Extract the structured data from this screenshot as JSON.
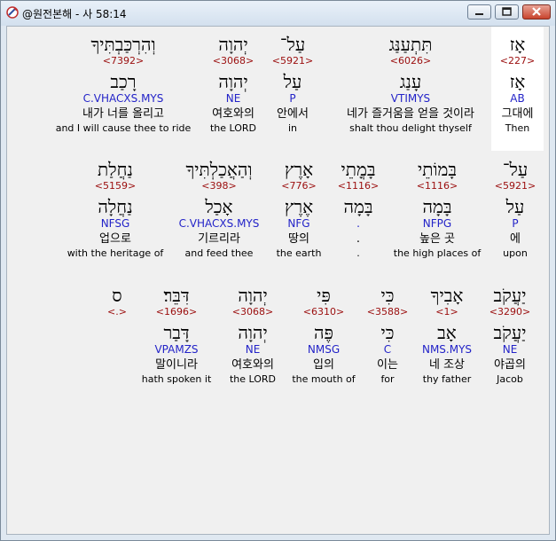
{
  "window": {
    "title": "@원전본해 - 사 58:14"
  },
  "rows": [
    [
      {
        "heb": "אָז",
        "num": "<227>",
        "lex": "אָז",
        "code": "AB",
        "kor": "그대에",
        "eng": "Then"
      },
      {
        "heb": "תִּתְעַנַּג",
        "num": "<6026>",
        "lex": "עָנַג",
        "code": "VTIMYS",
        "kor": "네가 즐거움을 얻을 것이라",
        "eng": "shalt thou delight thyself"
      },
      {
        "heb": "עַל־",
        "num": "<5921>",
        "lex": "עַל",
        "code": "P",
        "kor": "안에서",
        "eng": "in"
      },
      {
        "heb": "יְהוָה",
        "num": "<3068>",
        "lex": "יְהוָה",
        "code": "NE",
        "kor": "여호와의",
        "eng": "the LORD"
      },
      {
        "heb": "וְהִרְכַּבְתִּיךָ",
        "num": "<7392>",
        "lex": "רָכַב",
        "code": "C.VHACXS.MYS",
        "kor": "내가 너를 올리고",
        "eng": "and I will cause thee to ride"
      }
    ],
    [
      {
        "heb": "עַל־",
        "num": "<5921>",
        "lex": "עַל",
        "code": "P",
        "kor": "에",
        "eng": "upon"
      },
      {
        "heb": "בָּמוֹתֵי",
        "num": "<1116>",
        "lex": "בָּמָה",
        "code": "NFPG",
        "kor": "높은 곳",
        "eng": "the high places of"
      },
      {
        "heb": "בָּמֳתֵי",
        "num": "<1116>",
        "lex": "בָּמָה",
        "code": ".",
        "kor": ".",
        "eng": "."
      },
      {
        "heb": "אָרֶץ",
        "num": "<776>",
        "lex": "אֶרֶץ",
        "code": "NFG",
        "kor": "땅의",
        "eng": "the earth"
      },
      {
        "heb": "וְהַאֲכַלְתִּיךָ",
        "num": "<398>",
        "lex": "אָכַל",
        "code": "C.VHACXS.MYS",
        "kor": "기르리라",
        "eng": "and feed thee"
      },
      {
        "heb": "נַחֲלַת",
        "num": "<5159>",
        "lex": "נַחֲלָה",
        "code": "NFSG",
        "kor": "업으로",
        "eng": "with the heritage of"
      }
    ],
    [
      {
        "heb": "יַעֲקֹב",
        "num": "<3290>",
        "lex": "יַעֲקֹב",
        "code": "NE",
        "kor": "야곱의",
        "eng": "Jacob"
      },
      {
        "heb": "אָבִיךָ",
        "num": "<1>",
        "lex": "אָב",
        "code": "NMS.MYS",
        "kor": "네 조상",
        "eng": "thy father"
      },
      {
        "heb": "כִּי",
        "num": "<3588>",
        "lex": "כִּי",
        "code": "C",
        "kor": "이는",
        "eng": "for"
      },
      {
        "heb": "פִּי",
        "num": "<6310>",
        "lex": "פֶּה",
        "code": "NMSG",
        "kor": "입의",
        "eng": "the mouth of"
      },
      {
        "heb": "יְהוָה",
        "num": "<3068>",
        "lex": "יְהוָה",
        "code": "NE",
        "kor": "여호와의",
        "eng": "the LORD"
      },
      {
        "heb": "דִּבֵּר׃",
        "num": "<1696>",
        "lex": "דָּבַר",
        "code": "VPAMZS",
        "kor": "말이니라",
        "eng": "hath spoken it"
      },
      {
        "heb": "ס",
        "num": "<.>",
        "lex": "",
        "code": "",
        "kor": "",
        "eng": ""
      }
    ]
  ]
}
